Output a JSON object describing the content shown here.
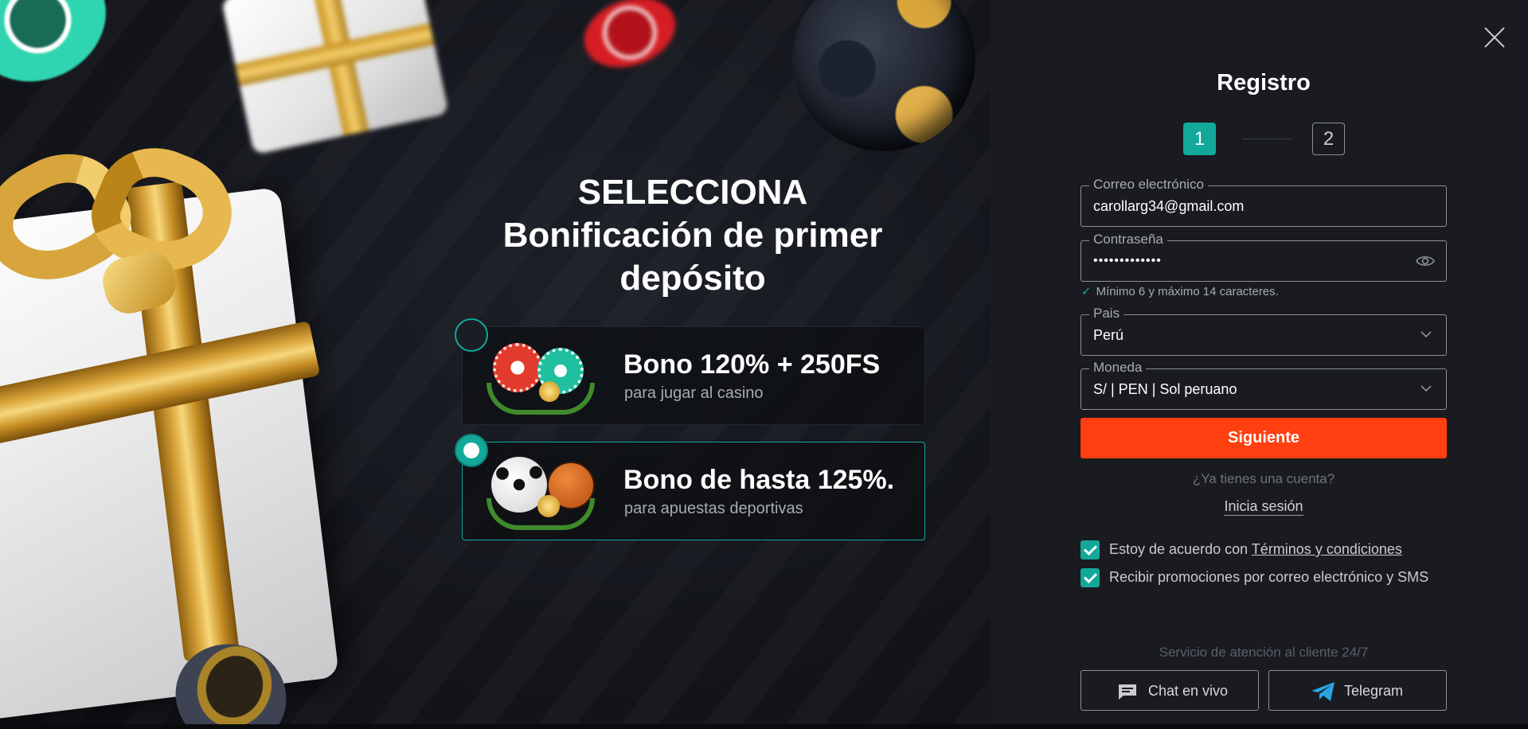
{
  "promo": {
    "headline_line1": "SELECCIONA",
    "headline_line2": "Bonificación de primer",
    "headline_line3": "depósito",
    "bonuses": [
      {
        "title": "Bono 120% + 250FS",
        "subtitle": "para jugar al casino",
        "selected": false
      },
      {
        "title": "Bono de hasta 125%.",
        "subtitle": "para apuestas deportivas",
        "selected": true
      }
    ]
  },
  "register": {
    "title": "Registro",
    "steps": [
      "1",
      "2"
    ],
    "active_step": 1,
    "email": {
      "label": "Correo electrónico",
      "value": "carollarg34@gmail.com"
    },
    "password": {
      "label": "Contraseña",
      "value": "•••••••••••••"
    },
    "password_hint": "Mínimo 6 y máximo 14 caracteres.",
    "country": {
      "label": "Pais",
      "value": "Perú"
    },
    "currency": {
      "label": "Moneda",
      "value": "S/ | PEN | Sol peruano"
    },
    "next_button": "Siguiente",
    "have_account": "¿Ya tienes una cuenta?",
    "login_link": "Inicia sesión",
    "terms_prefix": "Estoy de acuerdo con ",
    "terms_link": "Términos y condiciones",
    "promo_consent": "Recibir promociones por correo electrónico y SMS",
    "support_text": "Servicio de atención al cliente 24/7",
    "chat_button": "Chat en vivo",
    "telegram_button": "Telegram"
  },
  "colors": {
    "accent": "#12a89a",
    "cta": "#ff3f0f",
    "panel_bg": "#191b20",
    "telegram": "#2aa3e0"
  }
}
